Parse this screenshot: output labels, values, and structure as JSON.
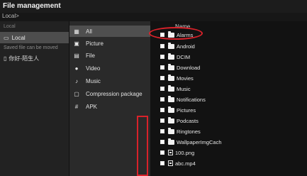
{
  "app": {
    "title": "File management",
    "breadcrumb": "Local>"
  },
  "left": {
    "section_label": "Local",
    "items": [
      {
        "label": "Local",
        "icon": "drive-icon",
        "active": true
      }
    ],
    "saved_text": "Saved file can be moved",
    "user": {
      "name": "你好-陌生人",
      "icon": "phone-icon"
    }
  },
  "categories": [
    {
      "label": "All",
      "icon": "grid-icon",
      "active": true
    },
    {
      "label": "Picture",
      "icon": "picture-icon"
    },
    {
      "label": "File",
      "icon": "file-icon"
    },
    {
      "label": "Video",
      "icon": "video-icon"
    },
    {
      "label": "Music",
      "icon": "music-icon"
    },
    {
      "label": "Compression package",
      "icon": "package-icon"
    },
    {
      "label": "APK",
      "icon": "apk-icon"
    }
  ],
  "files": {
    "header_name": "Name",
    "rows": [
      {
        "name": "Alarms",
        "type": "folder"
      },
      {
        "name": "Android",
        "type": "folder"
      },
      {
        "name": "DCIM",
        "type": "folder"
      },
      {
        "name": "Download",
        "type": "folder"
      },
      {
        "name": "Movies",
        "type": "folder"
      },
      {
        "name": "Music",
        "type": "folder"
      },
      {
        "name": "Notifications",
        "type": "folder"
      },
      {
        "name": "Pictures",
        "type": "folder"
      },
      {
        "name": "Podcasts",
        "type": "folder"
      },
      {
        "name": "Ringtones",
        "type": "folder"
      },
      {
        "name": "WallpaperImgCach",
        "type": "folder"
      },
      {
        "name": "100.png",
        "type": "image"
      },
      {
        "name": "abc.mp4",
        "type": "video"
      }
    ]
  },
  "colors": {
    "accent_red": "#d9222a",
    "background": "#171717"
  }
}
